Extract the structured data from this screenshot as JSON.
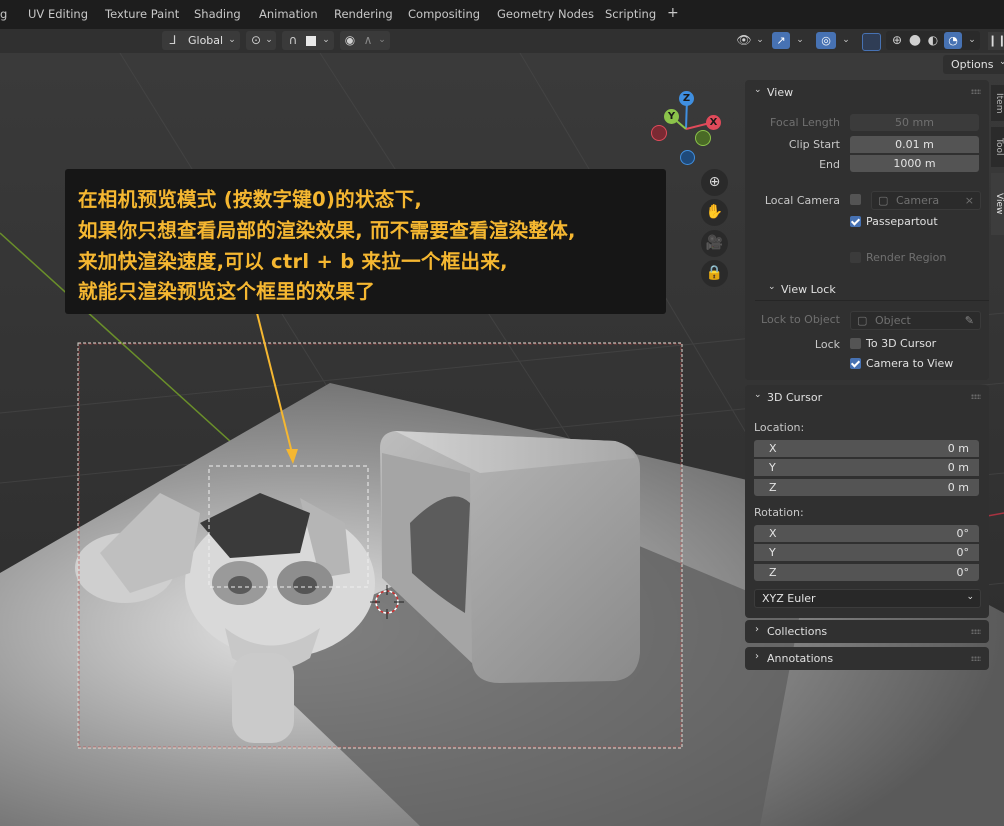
{
  "workspace_tabs": [
    "g",
    "UV Editing",
    "Texture Paint",
    "Shading",
    "Animation",
    "Rendering",
    "Compositing",
    "Geometry Nodes",
    "Scripting"
  ],
  "add_tab_icon": "plus-icon",
  "header": {
    "transform_orientation": "Global",
    "options_label": "Options"
  },
  "sidebar_tabs": [
    "Item",
    "Tool",
    "View"
  ],
  "view_panel": {
    "title": "View",
    "focal_length_label": "Focal Length",
    "focal_length_value": "50 mm",
    "clip_start_label": "Clip Start",
    "clip_start_value": "0.01 m",
    "end_label": "End",
    "end_value": "1000 m",
    "local_camera_label": "Local Camera",
    "camera_placeholder": "Camera",
    "passepartout_label": "Passepartout",
    "render_region_label": "Render Region",
    "view_lock_title": "View Lock",
    "lock_to_object_label": "Lock to Object",
    "object_placeholder": "Object",
    "lock_label": "Lock",
    "to_3d_cursor_label": "To 3D Cursor",
    "camera_to_view_label": "Camera to View"
  },
  "cursor_panel": {
    "title": "3D Cursor",
    "location_label": "Location:",
    "location": [
      {
        "axis": "X",
        "value": "0 m"
      },
      {
        "axis": "Y",
        "value": "0 m"
      },
      {
        "axis": "Z",
        "value": "0 m"
      }
    ],
    "rotation_label": "Rotation:",
    "rotation": [
      {
        "axis": "X",
        "value": "0°"
      },
      {
        "axis": "Y",
        "value": "0°"
      },
      {
        "axis": "Z",
        "value": "0°"
      }
    ],
    "rotation_mode": "XYZ Euler"
  },
  "collections_title": "Collections",
  "annotations_title": "Annotations",
  "gizmo": {
    "z": "Z",
    "y": "Y",
    "x": "X"
  },
  "annotation_text": {
    "line1": "在相机预览模式 (按数字键0)的状态下,",
    "line2": "如果你只想查看局部的渲染效果, 而不需要查看渲染整体,",
    "line3": "来加快渲染速度,可以 ctrl + b 来拉一个框出来,",
    "line4": "就能只渲染预览这个框里的效果了"
  },
  "colors": {
    "annotation_text": "#f5b731",
    "accent_blue": "#4772b3",
    "axis_x": "#e04a5a",
    "axis_y": "#8bc34a",
    "axis_z": "#3f8fe0"
  }
}
